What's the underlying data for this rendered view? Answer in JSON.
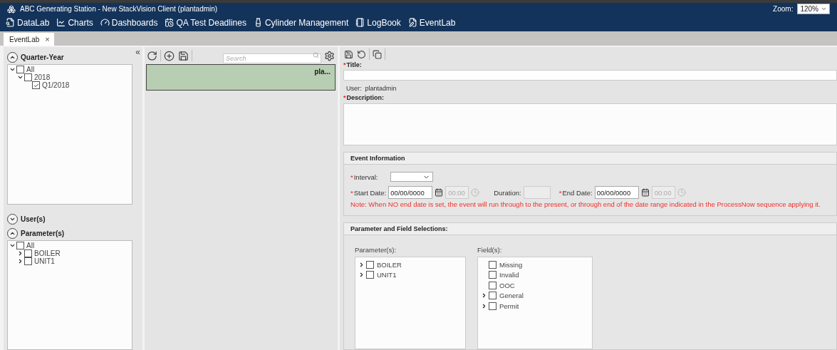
{
  "window": {
    "title": "ABC Generating Station - New StackVision Client (plantadmin)",
    "zoom_label": "Zoom:",
    "zoom_value": "120%"
  },
  "nav": [
    {
      "kind": "datalab",
      "label": "DataLab"
    },
    {
      "kind": "charts",
      "label": "Charts"
    },
    {
      "kind": "dashboards",
      "label": "Dashboards"
    },
    {
      "kind": "deadlines",
      "label": "QA Test Deadlines"
    },
    {
      "kind": "cylinder",
      "label": "Cylinder Management"
    },
    {
      "kind": "logbook",
      "label": "LogBook"
    },
    {
      "kind": "eventlab",
      "label": "EventLab"
    }
  ],
  "tabs": [
    {
      "label": "EventLab",
      "selected": true,
      "close": "×"
    }
  ],
  "filters": {
    "collapse": "«",
    "sections": [
      {
        "title": "Quarter-Year",
        "expanded": true,
        "tree": [
          {
            "label": "All",
            "checked": false,
            "expanded": true,
            "children": [
              {
                "label": "2018",
                "checked": false,
                "expanded": true,
                "children": [
                  {
                    "label": "Q1/2018",
                    "checked": true
                  }
                ]
              }
            ]
          }
        ]
      },
      {
        "title": "User(s)",
        "expanded": false
      },
      {
        "title": "Parameter(s)",
        "expanded": true,
        "tree": [
          {
            "label": "All",
            "checked": false,
            "expanded": true,
            "children": [
              {
                "label": "BOILER",
                "checked": false,
                "expanded": false
              },
              {
                "label": "UNIT1",
                "checked": false,
                "expanded": false
              }
            ]
          }
        ]
      }
    ]
  },
  "events": {
    "search": {
      "placeholder": "Search"
    },
    "cards": [
      {
        "label": "pla...",
        "selected": true
      }
    ]
  },
  "editor": {
    "required_mark": "*",
    "title_label": "Title:",
    "title_required": true,
    "user_label": "User:",
    "user_value": "plantadmin",
    "description_label": "Description:",
    "description_required": true,
    "event_info": {
      "heading": "Event Information",
      "interval_required": true,
      "start_required": true,
      "end_required": true,
      "interval_label": "Interval:",
      "start_label": "Start Date:",
      "start_date": "00/00/0000",
      "start_time": "00:00",
      "duration_label": "Duration:",
      "end_label": "End Date:",
      "end_date": "00/00/0000",
      "end_time": "00:00",
      "note": "Note: When NO end date is set, the event will run through to the present, or through end of the date range indicated in the ProcessNow sequence applying it."
    },
    "selections": {
      "heading": "Parameter and Field Selections:",
      "parameters_label": "Parameter(s):",
      "parameters": [
        {
          "label": "BOILER",
          "checked": false,
          "expanded": false
        },
        {
          "label": "UNIT1",
          "checked": false,
          "expanded": false
        }
      ],
      "fields_label": "Field(s):",
      "fields": [
        {
          "label": "Missing",
          "checked": false
        },
        {
          "label": "Invalid",
          "checked": false
        },
        {
          "label": "OOC",
          "checked": false
        },
        {
          "label": "General",
          "checked": false,
          "expanded": false
        },
        {
          "label": "Permit",
          "checked": false,
          "expanded": false
        }
      ]
    }
  }
}
